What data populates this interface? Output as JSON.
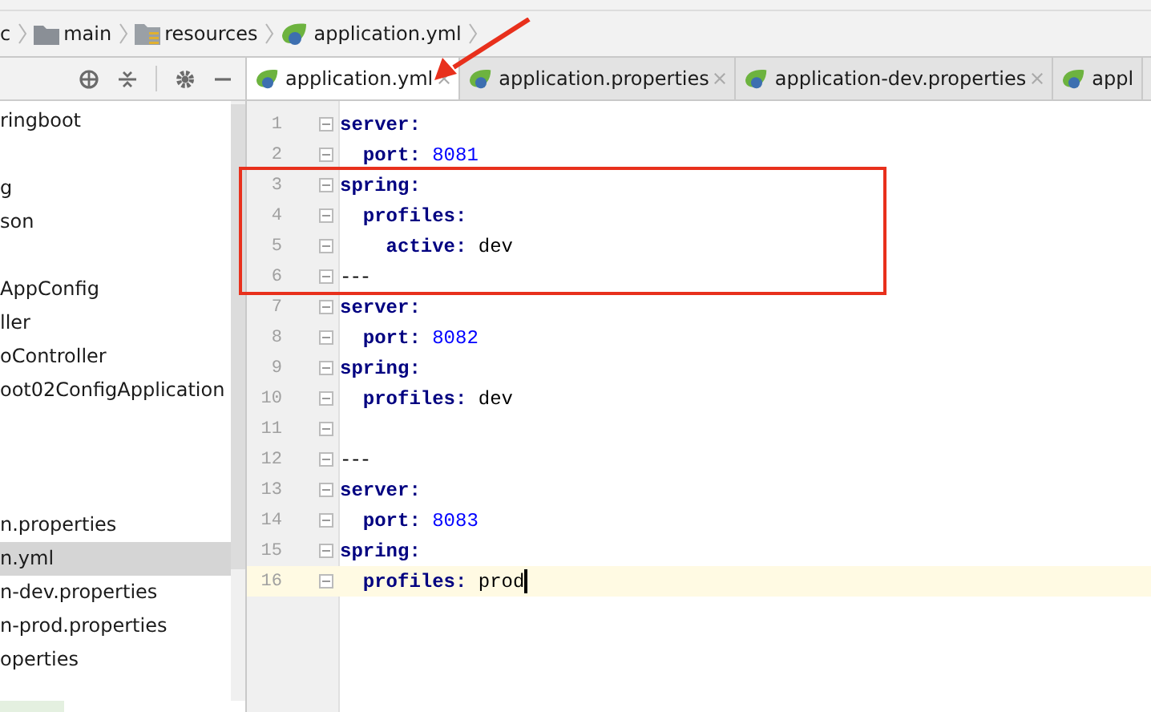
{
  "breadcrumb": [
    {
      "label": "c"
    },
    {
      "label": "main"
    },
    {
      "label": "resources"
    },
    {
      "label": "application.yml"
    }
  ],
  "project_tree": {
    "items": [
      {
        "label": "ringboot",
        "selected": false
      },
      {
        "selected": false
      },
      {
        "label": "g",
        "selected": false
      },
      {
        "label": "son",
        "selected": false
      },
      {
        "selected": false
      },
      {
        "label": "AppConfig",
        "selected": false
      },
      {
        "label": "ller",
        "selected": false
      },
      {
        "label": "oController",
        "selected": false
      },
      {
        "label": "oot02ConfigApplication",
        "selected": false
      },
      {
        "selected": false
      },
      {
        "selected": false
      },
      {
        "selected": false
      },
      {
        "label": "n.properties",
        "selected": false
      },
      {
        "label": "n.yml",
        "selected": true
      },
      {
        "label": "n-dev.properties",
        "selected": false
      },
      {
        "label": "n-prod.properties",
        "selected": false
      },
      {
        "label": "operties",
        "selected": false
      }
    ]
  },
  "tabs": [
    {
      "label": "application.yml",
      "selected": true,
      "closable": true
    },
    {
      "label": "application.properties",
      "selected": false,
      "closable": true
    },
    {
      "label": "application-dev.properties",
      "selected": false,
      "closable": true
    },
    {
      "label": "appl",
      "selected": false,
      "closable": false
    }
  ],
  "editor": {
    "lines": [
      {
        "number": "1",
        "kind": "key",
        "key": "server:"
      },
      {
        "number": "2",
        "kind": "number",
        "key": "  port:",
        "value": "8081"
      },
      {
        "number": "3",
        "kind": "key",
        "key": "spring:"
      },
      {
        "number": "4",
        "kind": "key",
        "key": "  profiles:"
      },
      {
        "number": "5",
        "kind": "string",
        "key": "    active:",
        "value": "dev"
      },
      {
        "number": "6",
        "kind": "separator",
        "text": "---"
      },
      {
        "number": "7",
        "kind": "key",
        "key": "server:"
      },
      {
        "number": "8",
        "kind": "number",
        "key": "  port:",
        "value": "8082"
      },
      {
        "number": "9",
        "kind": "key",
        "key": "spring:"
      },
      {
        "number": "10",
        "kind": "string",
        "key": "  profiles:",
        "value": "dev"
      },
      {
        "number": "11",
        "kind": "blank"
      },
      {
        "number": "12",
        "kind": "separator",
        "text": "---"
      },
      {
        "number": "13",
        "kind": "key",
        "key": "server:"
      },
      {
        "number": "14",
        "kind": "number",
        "key": "  port:",
        "value": "8083"
      },
      {
        "number": "15",
        "kind": "key",
        "key": "spring:"
      },
      {
        "number": "16",
        "kind": "string",
        "key": "  profiles:",
        "value": "prod",
        "current": true
      }
    ]
  }
}
